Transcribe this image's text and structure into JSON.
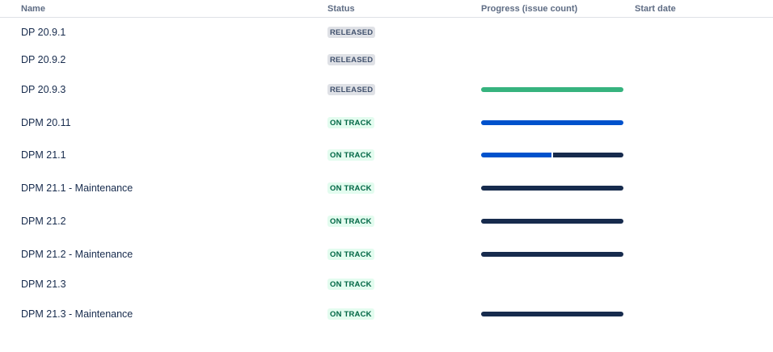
{
  "columns": {
    "name": "Name",
    "status": "Status",
    "progress": "Progress (issue count)",
    "start_date": "Start date"
  },
  "colors": {
    "done_green": "#36b37e",
    "in_progress_blue": "#0052cc",
    "todo_navy": "#172b4d"
  },
  "rows": [
    {
      "name": "DP 20.9.1",
      "status": "RELEASED",
      "status_kind": "released",
      "progress": null
    },
    {
      "name": "DP 20.9.2",
      "status": "RELEASED",
      "status_kind": "released",
      "progress": null
    },
    {
      "name": "DP 20.9.3",
      "status": "RELEASED",
      "status_kind": "released",
      "progress": {
        "done": 1.0,
        "in_progress": 0.0,
        "todo": 0.0
      }
    },
    {
      "name": "DPM 20.11",
      "status": "ON TRACK",
      "status_kind": "ontrack",
      "progress": {
        "done": 0.0,
        "in_progress": 1.0,
        "todo": 0.0
      }
    },
    {
      "name": "DPM 21.1",
      "status": "ON TRACK",
      "status_kind": "ontrack",
      "progress": {
        "done": 0.0,
        "in_progress": 0.5,
        "todo": 0.5
      }
    },
    {
      "name": "DPM 21.1 - Maintenance",
      "status": "ON TRACK",
      "status_kind": "ontrack",
      "progress": {
        "done": 0.0,
        "in_progress": 0.0,
        "todo": 1.0
      }
    },
    {
      "name": "DPM 21.2",
      "status": "ON TRACK",
      "status_kind": "ontrack",
      "progress": {
        "done": 0.0,
        "in_progress": 0.0,
        "todo": 1.0
      }
    },
    {
      "name": "DPM 21.2 - Maintenance",
      "status": "ON TRACK",
      "status_kind": "ontrack",
      "progress": {
        "done": 0.0,
        "in_progress": 0.0,
        "todo": 1.0
      }
    },
    {
      "name": "DPM 21.3",
      "status": "ON TRACK",
      "status_kind": "ontrack",
      "progress": null
    },
    {
      "name": "DPM 21.3 - Maintenance",
      "status": "ON TRACK",
      "status_kind": "ontrack",
      "progress": {
        "done": 0.0,
        "in_progress": 0.0,
        "todo": 1.0
      }
    }
  ]
}
